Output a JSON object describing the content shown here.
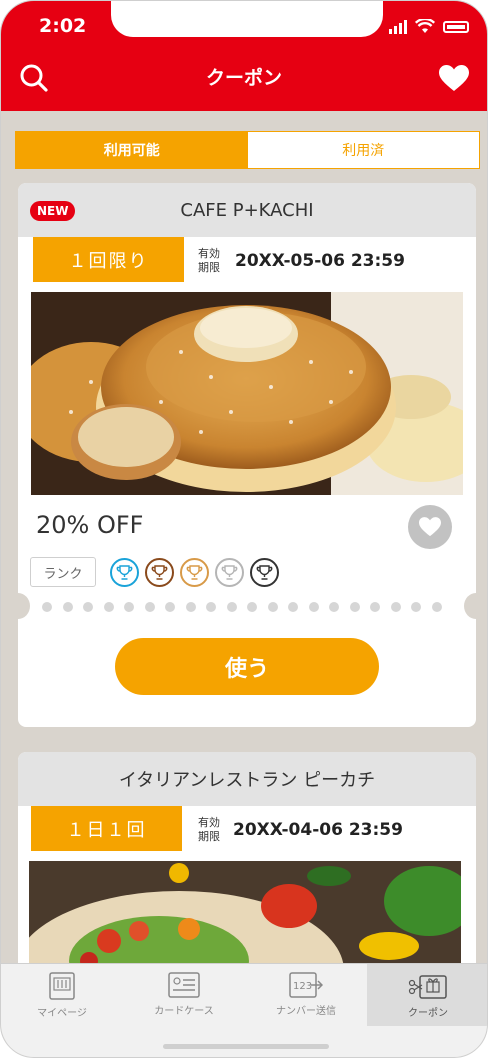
{
  "status_bar": {
    "time": "2:02"
  },
  "header": {
    "title": "クーポン",
    "search_icon": "search-icon",
    "favorite_icon": "heart-icon"
  },
  "tabs": [
    {
      "label": "利用可能",
      "active": true
    },
    {
      "label": "利用済",
      "active": false
    }
  ],
  "coupons": [
    {
      "badge": "NEW",
      "shop": "CAFE P+KACHI",
      "limit": "１回限り",
      "expire_label_1": "有効",
      "expire_label_2": "期限",
      "expire_date": "20XX-05-06 23:59",
      "image": "pancake-photo",
      "discount": "20% OFF",
      "rank_label": "ランク",
      "rank_colors": [
        "#1aa3d9",
        "#8a4a1c",
        "#d89a48",
        "#b5b5b5",
        "#333333"
      ],
      "use_button": "使う"
    },
    {
      "shop": "イタリアンレストラン ピーカチ",
      "limit": "１日１回",
      "expire_label_1": "有効",
      "expire_label_2": "期限",
      "expire_date": "20XX-04-06 23:59",
      "image": "salad-photo"
    }
  ],
  "tabbar": [
    {
      "label": "マイページ",
      "icon": "mypage-icon",
      "active": false
    },
    {
      "label": "カードケース",
      "icon": "card-case-icon",
      "active": false
    },
    {
      "label": "ナンバー送信",
      "icon": "number-send-icon",
      "active": false
    },
    {
      "label": "クーポン",
      "icon": "coupon-icon",
      "active": true
    }
  ],
  "colors": {
    "brand_red": "#e60012",
    "accent_orange": "#f5a300"
  }
}
